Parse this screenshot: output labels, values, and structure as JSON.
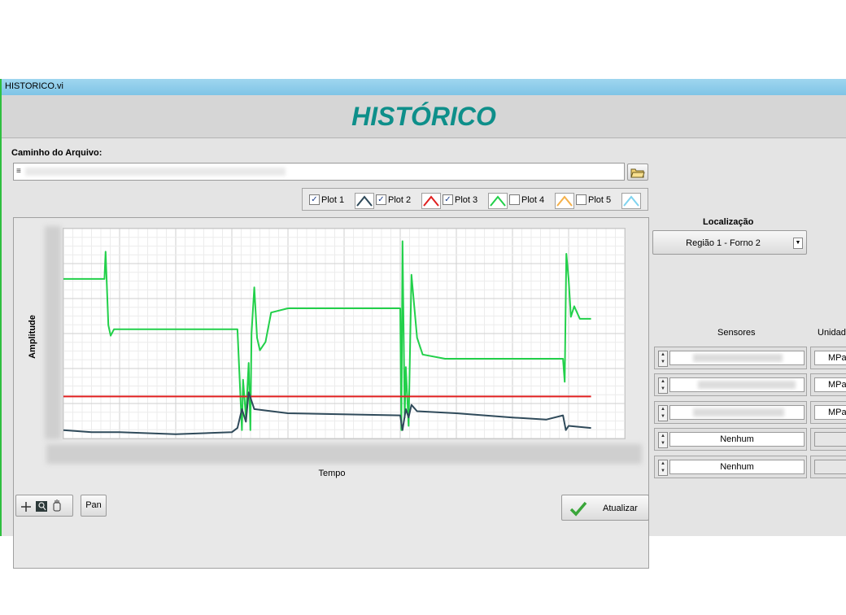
{
  "window": {
    "title": "HISTORICO.vi"
  },
  "header": {
    "title": "HISTÓRICO"
  },
  "file_path": {
    "label": "Caminho do Arquivo:",
    "value": ""
  },
  "legend": {
    "items": [
      {
        "label": "Plot 1",
        "checked": true,
        "color": "#2f4a5a"
      },
      {
        "label": "Plot 2",
        "checked": true,
        "color": "#e02020"
      },
      {
        "label": "Plot 3",
        "checked": true,
        "color": "#22d04a"
      },
      {
        "label": "Plot 4",
        "checked": false,
        "color": "#f5b14a"
      },
      {
        "label": "Plot 5",
        "checked": false,
        "color": "#7fd3ef"
      }
    ]
  },
  "graph": {
    "ylabel": "Amplitude",
    "xlabel": "Tempo"
  },
  "chart_data": {
    "type": "line",
    "xlabel": "Tempo",
    "ylabel": "Amplitude",
    "xlim": [
      0,
      100
    ],
    "ylim": [
      0,
      100
    ],
    "grid": true,
    "series": [
      {
        "name": "Plot 3",
        "color": "#22d04a",
        "x": [
          0,
          7.3,
          7.5,
          8,
          8.4,
          9,
          10,
          30,
          31,
          31.8,
          32,
          32.5,
          33,
          33.3,
          33.5,
          34,
          34.5,
          35,
          36,
          37,
          40,
          60,
          60.2,
          60.4,
          60.8,
          61,
          61.5,
          62,
          63,
          64,
          68,
          89,
          89.3,
          89.6,
          90,
          90.4,
          91,
          92,
          94
        ],
        "y": [
          76,
          76,
          89,
          54,
          49,
          52,
          52,
          52,
          52,
          4,
          28,
          10,
          36,
          4,
          50,
          72,
          48,
          42,
          46,
          60,
          62,
          62,
          4,
          94,
          10,
          34,
          6,
          78,
          48,
          40,
          38,
          38,
          27,
          88,
          76,
          58,
          63,
          57,
          57
        ]
      },
      {
        "name": "Plot 2",
        "color": "#e02020",
        "x": [
          0,
          94
        ],
        "y": [
          20,
          20
        ]
      },
      {
        "name": "Plot 1",
        "color": "#2f4a5a",
        "x": [
          0,
          5,
          10,
          20,
          30,
          31,
          31.8,
          32.5,
          33,
          34,
          40,
          60,
          60.4,
          61,
          61.5,
          62,
          63,
          70,
          80,
          86,
          89,
          89.5,
          90,
          94
        ],
        "y": [
          4,
          3,
          3,
          2,
          3,
          5,
          14,
          8,
          22,
          14,
          12,
          11,
          4,
          14,
          10,
          16,
          13,
          12,
          10,
          9,
          11,
          4,
          6,
          5
        ]
      }
    ]
  },
  "tools": {
    "pan_label": "Pan"
  },
  "refresh": {
    "label": "Atualizar"
  },
  "location": {
    "label": "Localização",
    "selected": "Região 1 - Forno 2"
  },
  "sensors": {
    "label": "Sensores",
    "units_label": "Unidade",
    "rows": [
      {
        "name": "",
        "unit": "MPa"
      },
      {
        "name": "",
        "unit": "MPa"
      },
      {
        "name": "",
        "unit": "MPa"
      },
      {
        "name": "Nenhum",
        "unit": ""
      },
      {
        "name": "Nenhum",
        "unit": ""
      }
    ]
  }
}
